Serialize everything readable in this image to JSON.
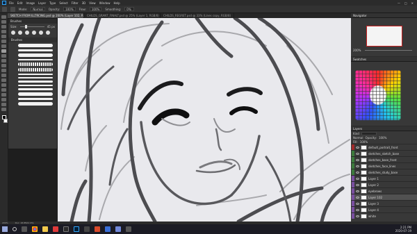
{
  "menubar": {
    "items": [
      "File",
      "Edit",
      "Image",
      "Layer",
      "Type",
      "Select",
      "Filter",
      "3D",
      "View",
      "Window",
      "Help"
    ],
    "controls": [
      "—",
      "□",
      "✕"
    ]
  },
  "options": {
    "mode_label": "Mode:",
    "mode_value": "Normal",
    "opacity_label": "Opacity:",
    "opacity_value": "100%",
    "flow_label": "Flow:",
    "flow_value": "100%",
    "smoothing_label": "Smoothing:",
    "smoothing_value": "0%"
  },
  "tabs": [
    {
      "label": "SKETCH FROM ILLTRCING.psd @ 200% (Layer 102, RGB/8)",
      "active": true
    },
    {
      "label": "CHILDS_GRANT_FINALT.psd @ 25% (Layer 1, RGB/8)",
      "active": false
    },
    {
      "label": "CHILDS_REGRET.psd @ 33% (Lines copy, RGB/8)",
      "active": false
    }
  ],
  "brushes": {
    "title": "Brushes",
    "size_label": "Size:",
    "size_value": "45 px",
    "folder_label": "Brushes"
  },
  "navigator": {
    "title": "Navigator",
    "zoom": "200%"
  },
  "swatches": {
    "title": "Swatches"
  },
  "layers": {
    "title": "Layers",
    "kind_label": "Kind",
    "blend": "Normal",
    "opacity_label": "Opacity:",
    "opacity_value": "100%",
    "fill_label": "Fill:",
    "fill_value": "100%",
    "items": [
      {
        "name": "default_portrait_front",
        "selected": false
      },
      {
        "name": "sketches_sketch_base",
        "selected": false
      },
      {
        "name": "sketches_base_front",
        "selected": false
      },
      {
        "name": "sketches_face_lines",
        "selected": false
      },
      {
        "name": "sketches_study_base",
        "selected": false
      },
      {
        "name": "Layer 1",
        "selected": false
      },
      {
        "name": "Layer 2",
        "selected": false
      },
      {
        "name": "eyebrows",
        "selected": false
      },
      {
        "name": "Layer 102",
        "selected": true
      },
      {
        "name": "Layer 3",
        "selected": false
      },
      {
        "name": "Layer 4",
        "selected": false
      },
      {
        "name": "white",
        "selected": false
      }
    ]
  },
  "statusbar": {
    "zoom": "200%",
    "doc": "Doc: 18.8M/2.17G"
  },
  "taskbar": {
    "time": "2:21 PM",
    "date": "2020-07-19"
  },
  "colors": {
    "layer_group_tag": "#7a4fa0",
    "layer_green_tag": "#3c7a3c",
    "nav_frame": "#cc2222"
  }
}
